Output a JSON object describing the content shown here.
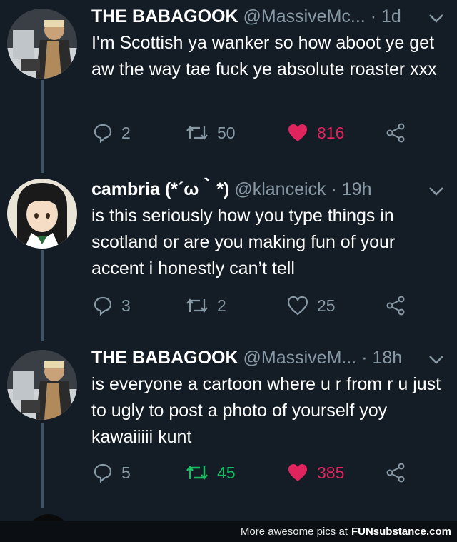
{
  "tweets": [
    {
      "name": "THE BABAGOOK",
      "handle": "@MassiveMc...",
      "time": "· 1d",
      "text": "I'm Scottish ya wanker so how aboot ye get aw the way tae fuck ye absolute roaster xxx",
      "replies": "2",
      "retweets": "50",
      "likes": "816",
      "liked": true,
      "retweeted": false
    },
    {
      "name": "cambria (*´ω｀*)",
      "handle": "@klanceick",
      "time": "· 19h",
      "text": "is this seriously how you type things in scotland or are you making fun of your accent i honestly can’t tell",
      "replies": "3",
      "retweets": "2",
      "likes": "25",
      "liked": false,
      "retweeted": false
    },
    {
      "name": "THE BABAGOOK",
      "handle": "@MassiveM...",
      "time": "· 18h",
      "text": "is everyone a cartoon where u r from r u just to ugly to post a photo of yourself yoy kawaiiiii kunt",
      "replies": "5",
      "retweets": "45",
      "likes": "385",
      "liked": true,
      "retweeted": true
    }
  ],
  "footer": {
    "text": "More awesome pics at",
    "brand": "FUNsubstance.com"
  },
  "colors": {
    "background": "#141d26",
    "like": "#e0245e",
    "retweet": "#17bf63",
    "muted": "#8899a6"
  },
  "icons": [
    "reply-icon",
    "retweet-icon",
    "heart-icon",
    "share-icon",
    "chevron-down-icon"
  ]
}
